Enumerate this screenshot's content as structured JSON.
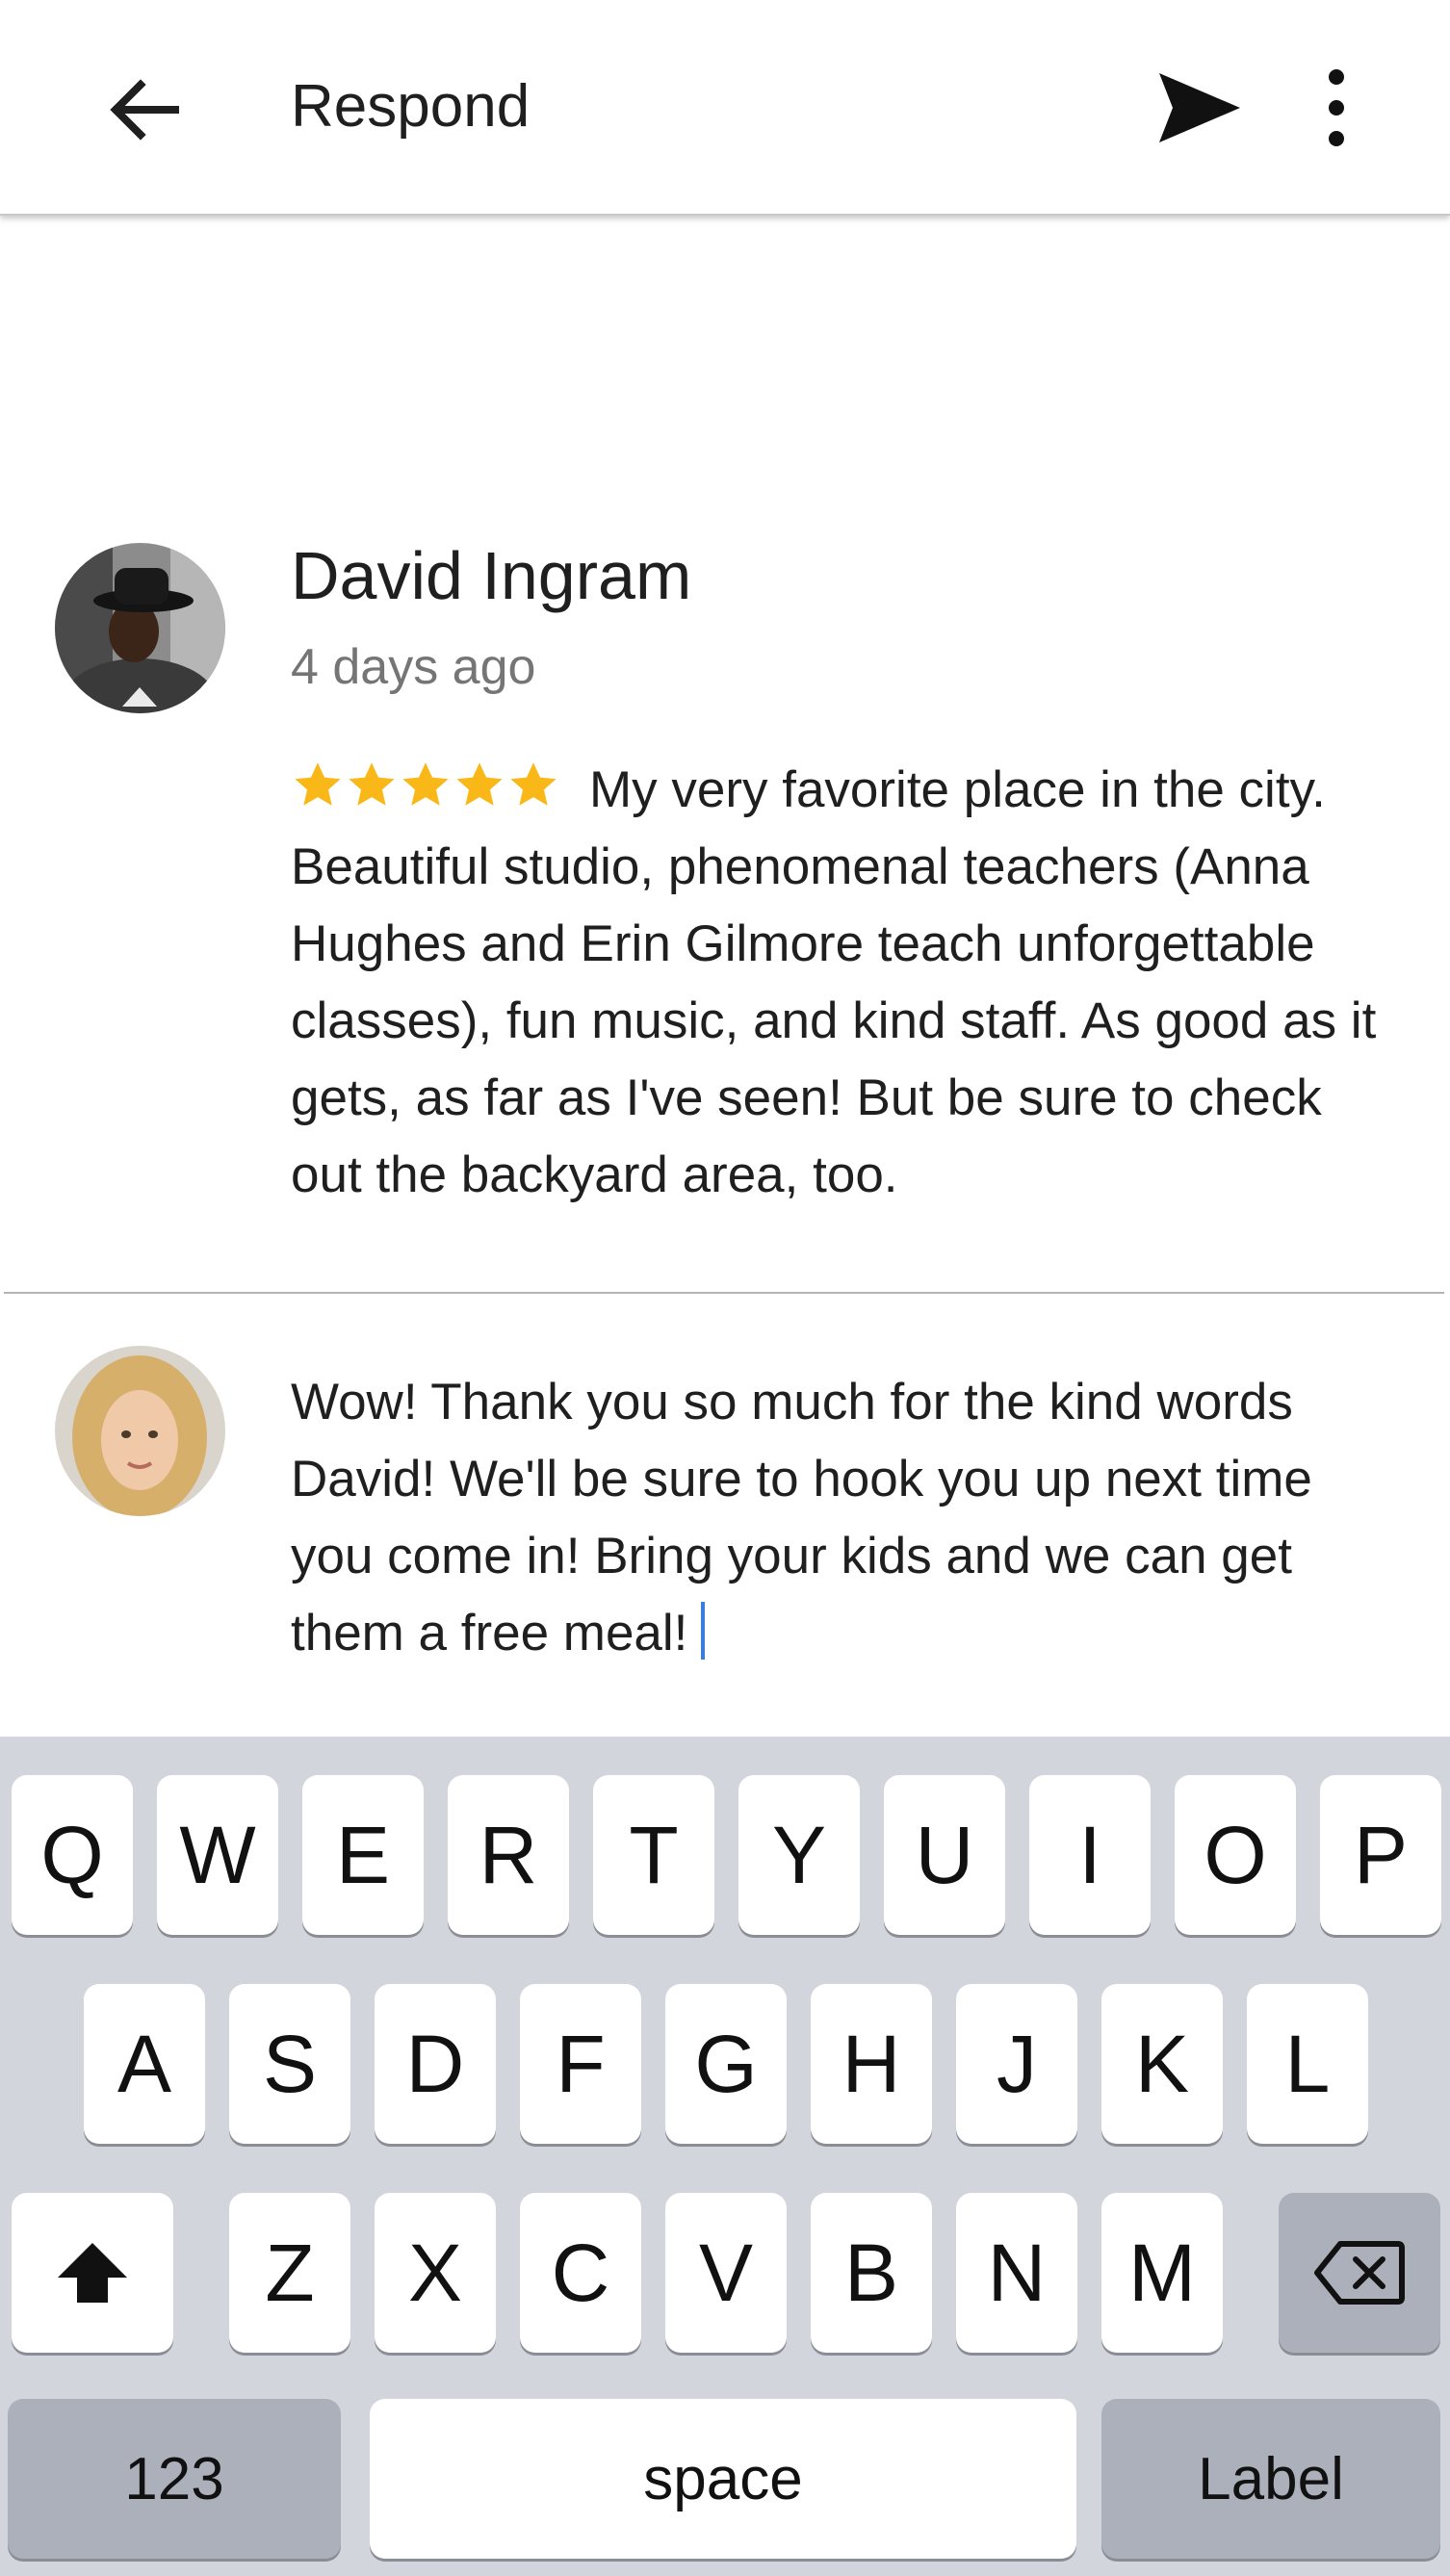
{
  "appbar": {
    "title": "Respond",
    "back_icon": "arrow-back-icon",
    "send_icon": "send-icon",
    "more_icon": "more-vert-icon"
  },
  "review": {
    "name": "David Ingram",
    "time": "4 days ago",
    "rating": 5,
    "text": "My very favorite place in the city. Beautiful studio, phenomenal teachers (Anna Hughes and Erin Gilmore teach unforgettable classes), fun music, and kind staff. As good as it gets, as far as I've seen! But be sure to check out the backyard area, too."
  },
  "reply": {
    "text": "Wow! Thank you so much for the kind words David! We'll be sure to hook you up next time you come in! Bring your kids and we can get them a free meal!"
  },
  "keyboard": {
    "row1": [
      "Q",
      "W",
      "E",
      "R",
      "T",
      "Y",
      "U",
      "I",
      "O",
      "P"
    ],
    "row2": [
      "A",
      "S",
      "D",
      "F",
      "G",
      "H",
      "J",
      "K",
      "L"
    ],
    "row3": [
      "Z",
      "X",
      "C",
      "V",
      "B",
      "N",
      "M"
    ],
    "numbers_label": "123",
    "space_label": "space",
    "action_label": "Label",
    "shift_icon": "shift-icon",
    "backspace_icon": "backspace-icon"
  },
  "colors": {
    "star": "#F9B817",
    "caret": "#3B7DDD",
    "keyboard_bg": "#D2D5DC",
    "key_dark": "#ABB0BA"
  }
}
